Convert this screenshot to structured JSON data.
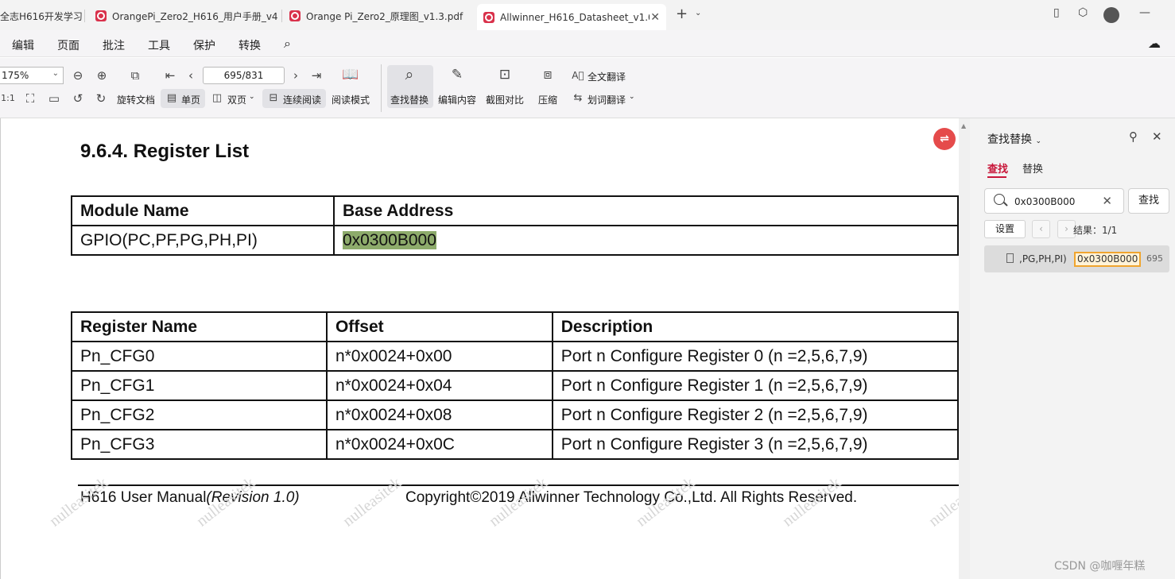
{
  "tabs": [
    {
      "label": "全志H616开发学习",
      "active": false
    },
    {
      "label": "OrangePi_Zero2_H616_用户手册_v4",
      "active": false
    },
    {
      "label": "Orange Pi_Zero2_原理图_v1.3.pdf",
      "active": false
    },
    {
      "label": "Allwinner_H616_Datasheet_v1.0.",
      "active": true
    }
  ],
  "menu": [
    "编辑",
    "页面",
    "批注",
    "工具",
    "保护",
    "转换"
  ],
  "toolbar": {
    "zoom": "175%",
    "page_indicator": "695/831",
    "rotate_label": "旋转文档",
    "single_label": "单页",
    "double_label": "双页",
    "continuous_label": "连续阅读",
    "read_mode_label": "阅读模式",
    "find_replace_label": "查找替换",
    "edit_content_label": "编辑内容",
    "screenshot_compare_label": "截图对比",
    "compress_label": "压缩",
    "full_translate_label": "全文翻译",
    "word_translate_label": "划词翻译"
  },
  "document": {
    "section_title": "9.6.4. Register List",
    "module_table": {
      "headers": [
        "Module Name",
        "Base Address"
      ],
      "rows": [
        [
          "GPIO(PC,PF,PG,PH,PI)",
          "0x0300B000"
        ]
      ]
    },
    "register_table": {
      "headers": [
        "Register Name",
        "Offset",
        "Description"
      ],
      "rows": [
        [
          "Pn_CFG0",
          "n*0x0024+0x00",
          "Port n Configure Register 0 (n =2,5,6,7,9)"
        ],
        [
          "Pn_CFG1",
          "n*0x0024+0x04",
          "Port n Configure Register 1 (n =2,5,6,7,9)"
        ],
        [
          "Pn_CFG2",
          "n*0x0024+0x08",
          "Port n Configure Register 2 (n =2,5,6,7,9)"
        ],
        [
          "Pn_CFG3",
          "n*0x0024+0x0C",
          "Port n Configure Register 3 (n =2,5,6,7,9)"
        ]
      ]
    },
    "footer_left": "H616 User Manual",
    "footer_left_italic": "(Revision 1.0)",
    "footer_right": "Copyright©2019 Allwinner Technology Co.,Ltd. All Rights Reserved.",
    "watermark": "nulleasitek"
  },
  "side_panel": {
    "title": "查找替换",
    "tab_find": "查找",
    "tab_replace": "替换",
    "search_value": "0x0300B000",
    "find_button": "查找",
    "settings_button": "设置",
    "result_count": "结果：1/1",
    "result_context": ",PG,PH,PI)",
    "result_match": "0x0300B000",
    "result_page": "695"
  },
  "csdn_watermark": "CSDN @咖喱年糕",
  "colors": {
    "highlight": "#8dab6b",
    "accent": "#c8173a",
    "match_border": "#f0a52e"
  }
}
